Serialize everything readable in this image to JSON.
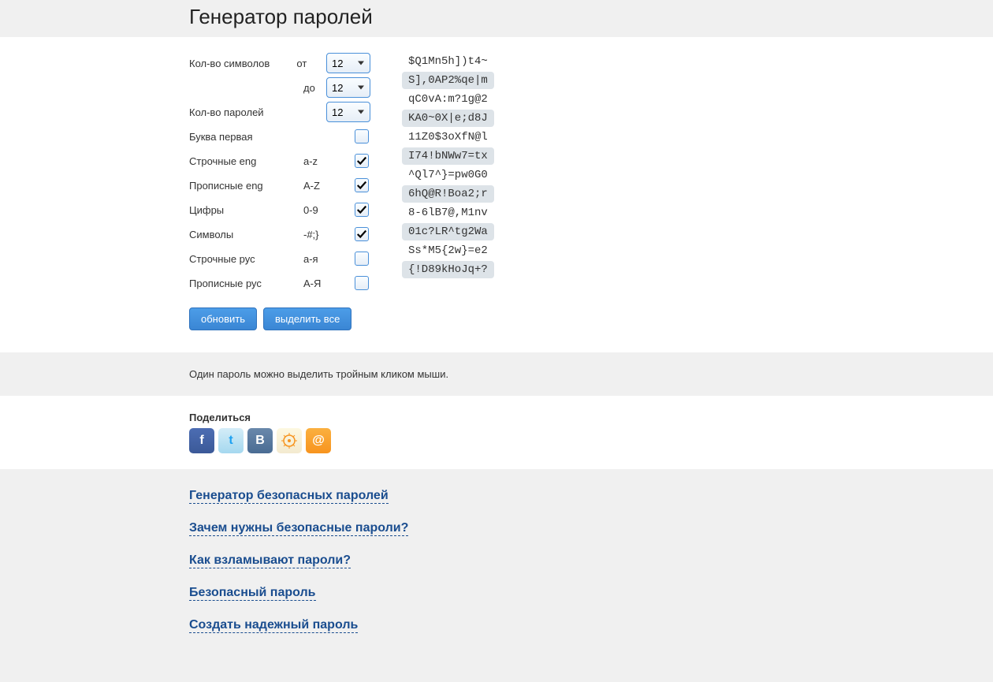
{
  "title": "Генератор паролей",
  "form": {
    "chars_label": "Кол-во символов",
    "from_label": "от",
    "to_label": "до",
    "from_value": "12",
    "to_value": "12",
    "count_label": "Кол-во паролей",
    "count_value": "12",
    "first_letter_label": "Буква первая",
    "first_letter_checked": false,
    "lower_eng_label": "Строчные eng",
    "lower_eng_range": "a-z",
    "lower_eng_checked": true,
    "upper_eng_label": "Прописные eng",
    "upper_eng_range": "A-Z",
    "upper_eng_checked": true,
    "digits_label": "Цифры",
    "digits_range": "0-9",
    "digits_checked": true,
    "symbols_label": "Символы",
    "symbols_range": "-#;}",
    "symbols_checked": true,
    "lower_rus_label": "Строчные рус",
    "lower_rus_range": "а-я",
    "lower_rus_checked": false,
    "upper_rus_label": "Прописные рус",
    "upper_rus_range": "А-Я",
    "upper_rus_checked": false,
    "refresh_btn": "обновить",
    "select_all_btn": "выделить все"
  },
  "passwords": [
    "$Q1Mn5h])t4~",
    "S],0AP2%qe|m",
    "qC0vA:m?1g@2",
    "KA0~0X|e;d8J",
    "11Z0$3oXfN@l",
    "I74!bNWw7=tx",
    "^Ql7^}=pw0G0",
    "6hQ@R!Boa2;r",
    "8-6lB7@,M1nv",
    "01c?LR^tg2Wa",
    "Ss*M5{2w}=e2",
    "{!D89kHoJq+?"
  ],
  "tip": "Один пароль можно выделить тройным кликом мыши.",
  "share": {
    "title": "Поделиться",
    "icons": {
      "fb": "f",
      "tw": "t",
      "vk": "B",
      "ok": "⊙",
      "mm": "@"
    }
  },
  "links": [
    "Генератор безопасных паролей",
    "Зачем нужны безопасные пароли?",
    "Как взламывают пароли?",
    "Безопасный пароль",
    "Создать надежный пароль"
  ]
}
